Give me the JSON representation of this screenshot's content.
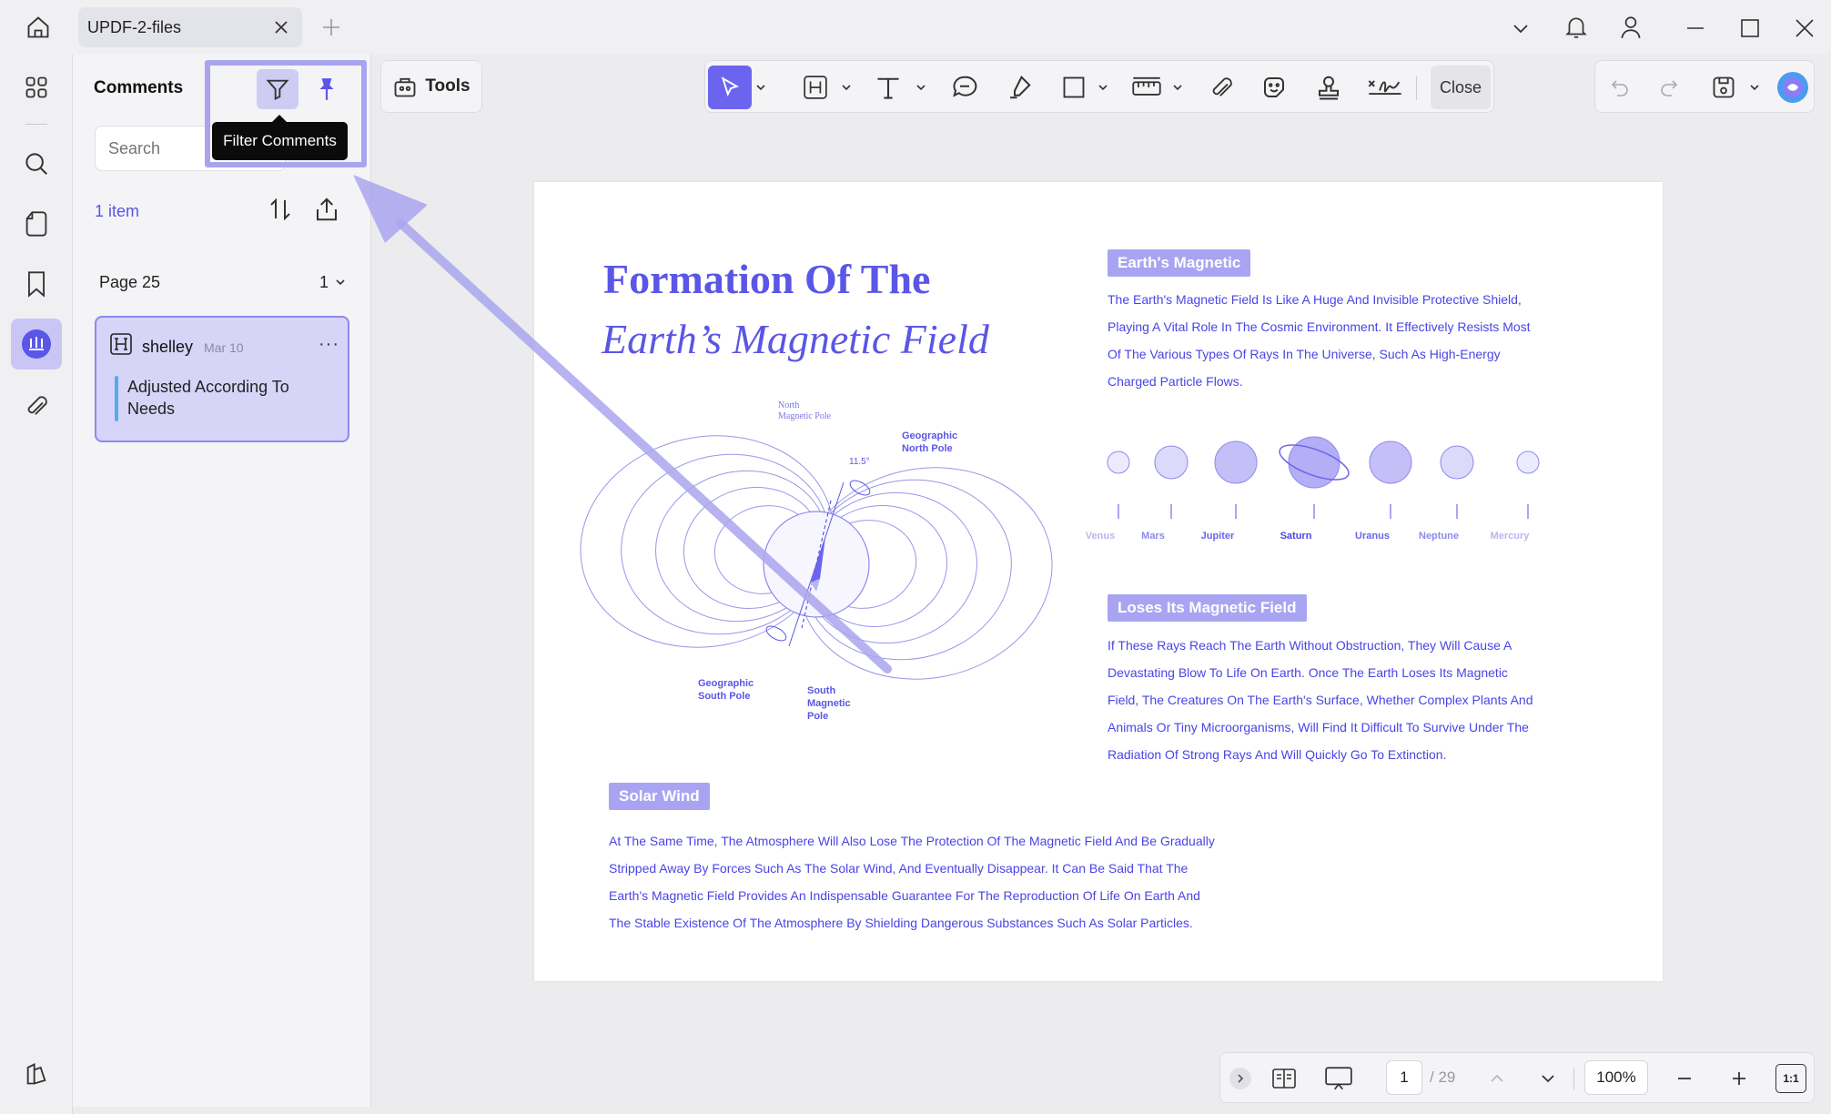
{
  "tab": {
    "title": "UPDF-2-files"
  },
  "panel": {
    "title": "Comments",
    "search_placeholder": "Search",
    "count": "1 item",
    "tooltip": "Filter Comments",
    "page_label": "Page 25",
    "page_count": "1",
    "comment": {
      "author": "shelley",
      "date": "Mar 10",
      "text": "Adjusted According To Needs"
    }
  },
  "toolbar": {
    "tools_label": "Tools",
    "close_label": "Close"
  },
  "document": {
    "title_line1": "Formation Of The",
    "title_line2": "Earth’s Magnetic Field",
    "section1": {
      "heading": "Earth's Magnetic",
      "lines": [
        "The Earth's Magnetic Field Is Like A Huge And Invisible Protective Shield,",
        "Playing A Vital Role In The Cosmic Environment. It Effectively Resists Most",
        "Of The Various Types Of Rays In The Universe, Such As High-Energy",
        "Charged Particle Flows."
      ]
    },
    "planets": [
      "Venus",
      "Mars",
      "Jupiter",
      "Saturn",
      "Uranus",
      "Neptune",
      "Mercury"
    ],
    "section2": {
      "heading": "Loses Its Magnetic Field",
      "lines": [
        "If These Rays Reach The Earth Without Obstruction, They Will Cause A",
        "Devastating Blow To Life On Earth. Once The Earth Loses Its Magnetic",
        "Field, The Creatures On The Earth's Surface, Whether Complex Plants And",
        "Animals Or Tiny Microorganisms, Will Find It Difficult To Survive Under The",
        "Radiation Of Strong Rays And Will Quickly Go To Extinction."
      ]
    },
    "section3": {
      "heading": "Solar Wind",
      "lines": [
        "At The Same Time, The Atmosphere Will Also Lose The Protection Of The Magnetic Field And Be Gradually",
        "Stripped Away By Forces Such As The Solar Wind, And Eventually Disappear. It Can Be Said That The",
        "Earth's Magnetic Field Provides An Indispensable Guarantee For The Reproduction Of Life On Earth And",
        "The Stable Existence Of The Atmosphere By Shielding Dangerous Substances Such As Solar Particles."
      ]
    },
    "diagram": {
      "north_magnetic_pole": [
        "North",
        "Magnetic Pole"
      ],
      "geographic_north_pole": [
        "Geographic",
        "North Pole"
      ],
      "angle": "11.5°",
      "geographic_south_pole": [
        "Geographic",
        "South Pole"
      ],
      "south_magnetic_pole": [
        "South",
        "Magnetic",
        "Pole"
      ]
    }
  },
  "bottombar": {
    "page_current": "1",
    "page_total": "/ 29",
    "zoom": "100%",
    "fit_label": "1:1"
  },
  "colors": {
    "accent": "#5a56e6",
    "badge": "#a9a4f1",
    "highlight": "#a8a4ee",
    "active_rail": "#c9c6f5"
  }
}
